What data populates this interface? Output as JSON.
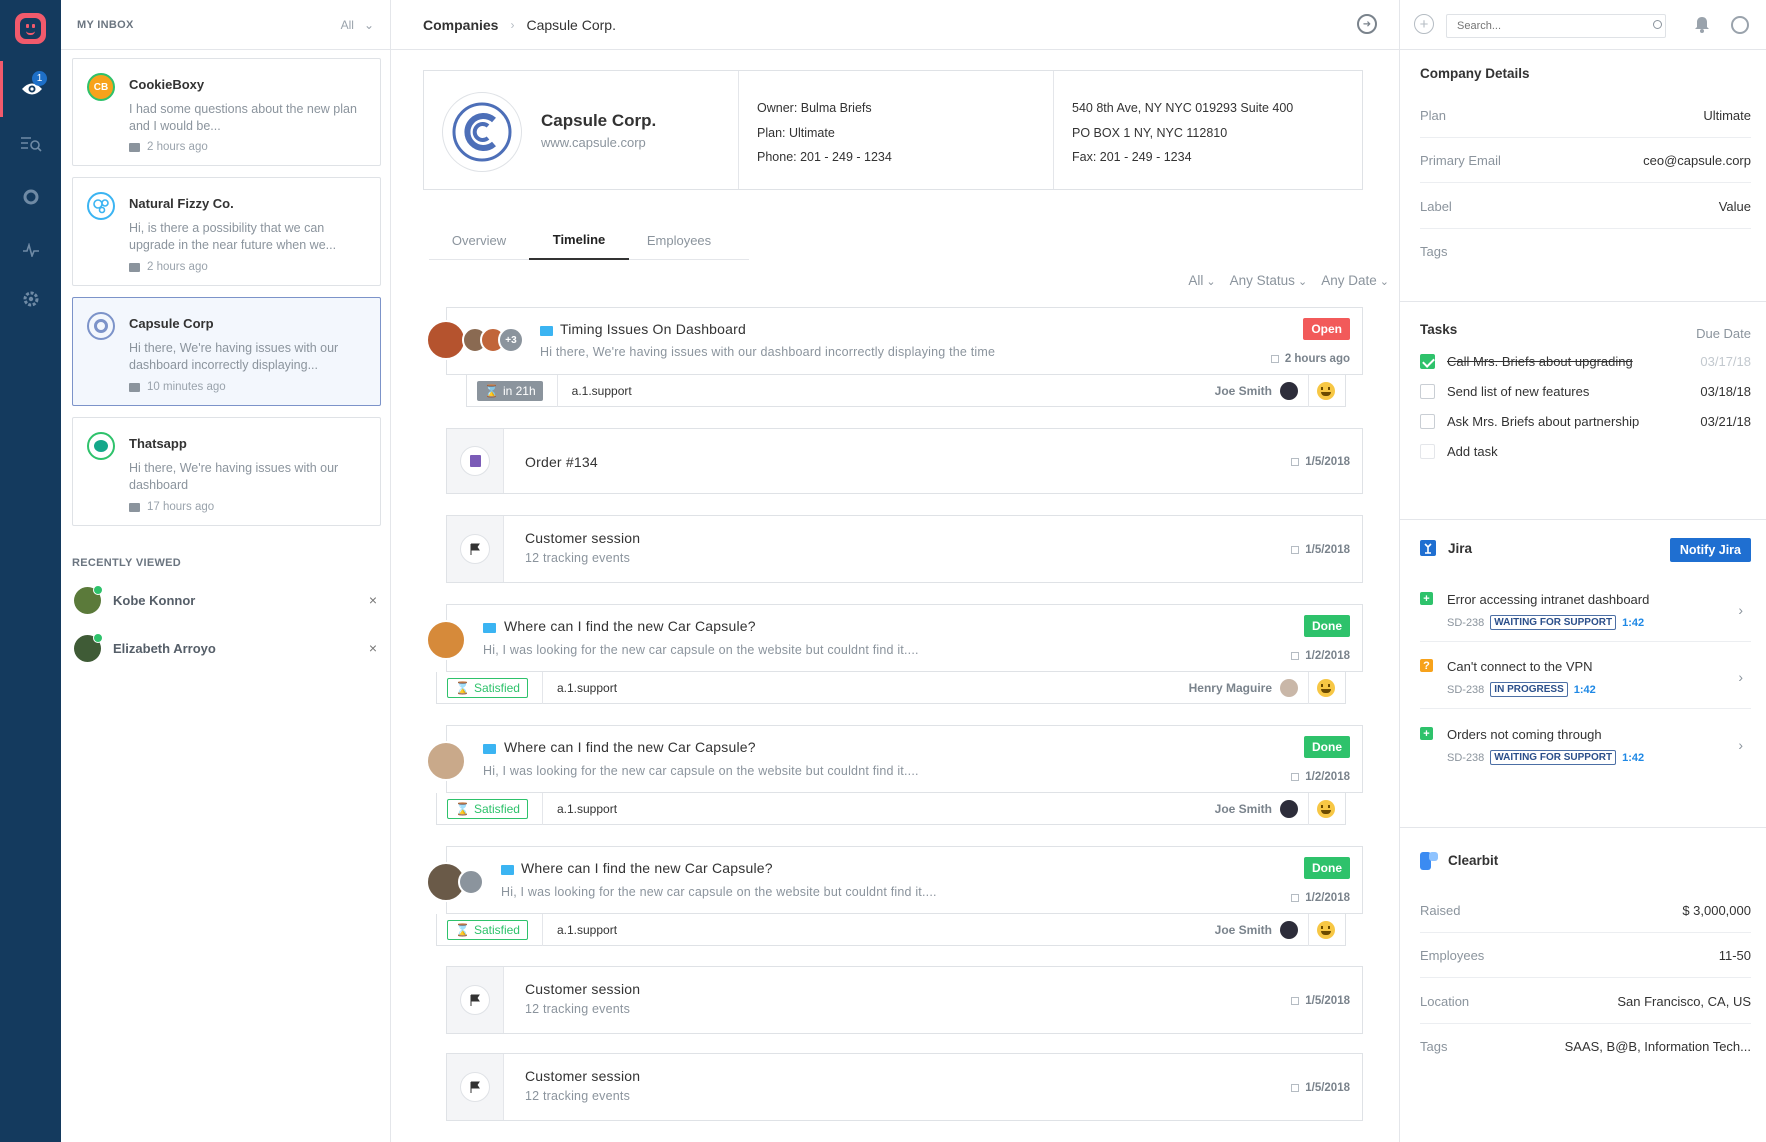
{
  "inbox": {
    "title": "MY INBOX",
    "filter": "All",
    "conversations": [
      {
        "name": "CookieBoxy",
        "logo_text": "CB",
        "message": "I had some questions about the new plan and I would be...",
        "time": "2 hours ago"
      },
      {
        "name": "Natural Fizzy Co.",
        "message": "Hi, is there a possibility that we can upgrade in the near future when we...",
        "time": "2 hours ago"
      },
      {
        "name": "Capsule Corp",
        "message": "Hi there, We're having issues with our dashboard incorrectly displaying...",
        "time": "10 minutes ago"
      },
      {
        "name": "Thatsapp",
        "message": "Hi there, We're having issues with our dashboard",
        "time": "17 hours ago"
      }
    ],
    "recent_title": "RECENTLY VIEWED",
    "recent": [
      {
        "name": "Kobe Konnor"
      },
      {
        "name": "Elizabeth Arroyo"
      }
    ]
  },
  "nav": {
    "badge": "1"
  },
  "breadcrumb": {
    "parent": "Companies",
    "current": "Capsule Corp."
  },
  "company": {
    "name": "Capsule Corp.",
    "url": "www.capsule.corp",
    "logo_text": "CAPSULE CORP.",
    "owner": "Owner: Bulma Briefs",
    "plan": "Plan: Ultimate",
    "phone": "Phone: 201 - 249 - 1234",
    "address": "540 8th Ave, NY NYC 019293 Suite 400",
    "pobox": "PO BOX 1 NY, NYC 112810",
    "fax": "Fax: 201 - 249 - 1234"
  },
  "tabs": [
    "Overview",
    "Timeline",
    "Employees"
  ],
  "filters": [
    "All",
    "Any Status",
    "Any Date"
  ],
  "timeline": {
    "t1": {
      "title": "Timing Issues On Dashboard",
      "snippet": "Hi there, We're having issues with our dashboard incorrectly displaying the time",
      "status": "Open",
      "time": "2 hours ago",
      "tag": "in 21h",
      "team": "a.1.support",
      "agent": "Joe Smith",
      "extra": "+3"
    },
    "t2": {
      "title": "Order #134",
      "time": "1/5/2018"
    },
    "t3": {
      "title": "Customer session",
      "sub": "12 tracking events",
      "time": "1/5/2018"
    },
    "t4": {
      "title": "Where can I find the new Car Capsule?",
      "snippet": "Hi,  I was looking for the new car capsule on the website but couldnt find it....",
      "status": "Done",
      "time": "1/2/2018",
      "tag": "Satisfied",
      "team": "a.1.support",
      "agent": "Henry Maguire"
    },
    "t5": {
      "title": "Where can I find the new Car Capsule?",
      "snippet": "Hi,  I was looking for the new car capsule on the website but couldnt find it....",
      "status": "Done",
      "time": "1/2/2018",
      "tag": "Satisfied",
      "team": "a.1.support",
      "agent": "Joe Smith"
    },
    "t6": {
      "title": "Where can I find the new Car Capsule?",
      "snippet": "Hi,  I was looking for the new car capsule on the website but couldnt find it....",
      "status": "Done",
      "time": "1/2/2018",
      "tag": "Satisfied",
      "team": "a.1.support",
      "agent": "Joe Smith"
    },
    "t7": {
      "title": "Customer session",
      "sub": "12 tracking events",
      "time": "1/5/2018"
    },
    "t8": {
      "title": "Customer session",
      "sub": "12 tracking events",
      "time": "1/5/2018"
    }
  },
  "right": {
    "search_placeholder": "Search...",
    "details": {
      "title": "Company Details",
      "rows": [
        {
          "k": "Plan",
          "v": "Ultimate"
        },
        {
          "k": "Primary Email",
          "v": "ceo@capsule.corp"
        },
        {
          "k": "Label",
          "v": "Value"
        },
        {
          "k": "Tags",
          "v": ""
        }
      ]
    },
    "tasks": {
      "title": "Tasks",
      "due_label": "Due Date",
      "items": [
        {
          "name": "Call Mrs. Briefs about upgrading",
          "date": "03/17/18",
          "done": true
        },
        {
          "name": "Send list of new features",
          "date": "03/18/18",
          "done": false
        },
        {
          "name": "Ask Mrs. Briefs about partnership",
          "date": "03/21/18",
          "done": false
        }
      ],
      "add_label": "Add task"
    },
    "jira": {
      "title": "Jira",
      "button": "Notify Jira",
      "issues": [
        {
          "title": "Error accessing intranet dashboard",
          "key": "SD-238",
          "status": "WAITING FOR SUPPORT",
          "time": "1:42",
          "icon": "+"
        },
        {
          "title": "Can't connect to the VPN",
          "key": "SD-238",
          "status": "IN PROGRESS",
          "time": "1:42",
          "icon": "?"
        },
        {
          "title": "Orders not coming through",
          "key": "SD-238",
          "status": "WAITING FOR SUPPORT",
          "time": "1:42",
          "icon": "+"
        }
      ]
    },
    "clearbit": {
      "title": "Clearbit",
      "rows": [
        {
          "k": "Raised",
          "v": "$ 3,000,000"
        },
        {
          "k": "Employees",
          "v": "11-50"
        },
        {
          "k": "Location",
          "v": "San Francisco, CA, US"
        },
        {
          "k": "Tags",
          "v": "SAAS, B@B, Information Tech..."
        }
      ]
    }
  },
  "colors": {
    "nav": "#143a5e",
    "accent_red": "#f25a5a",
    "accent_green": "#2ec26b",
    "accent_blue": "#1f6fd1"
  }
}
